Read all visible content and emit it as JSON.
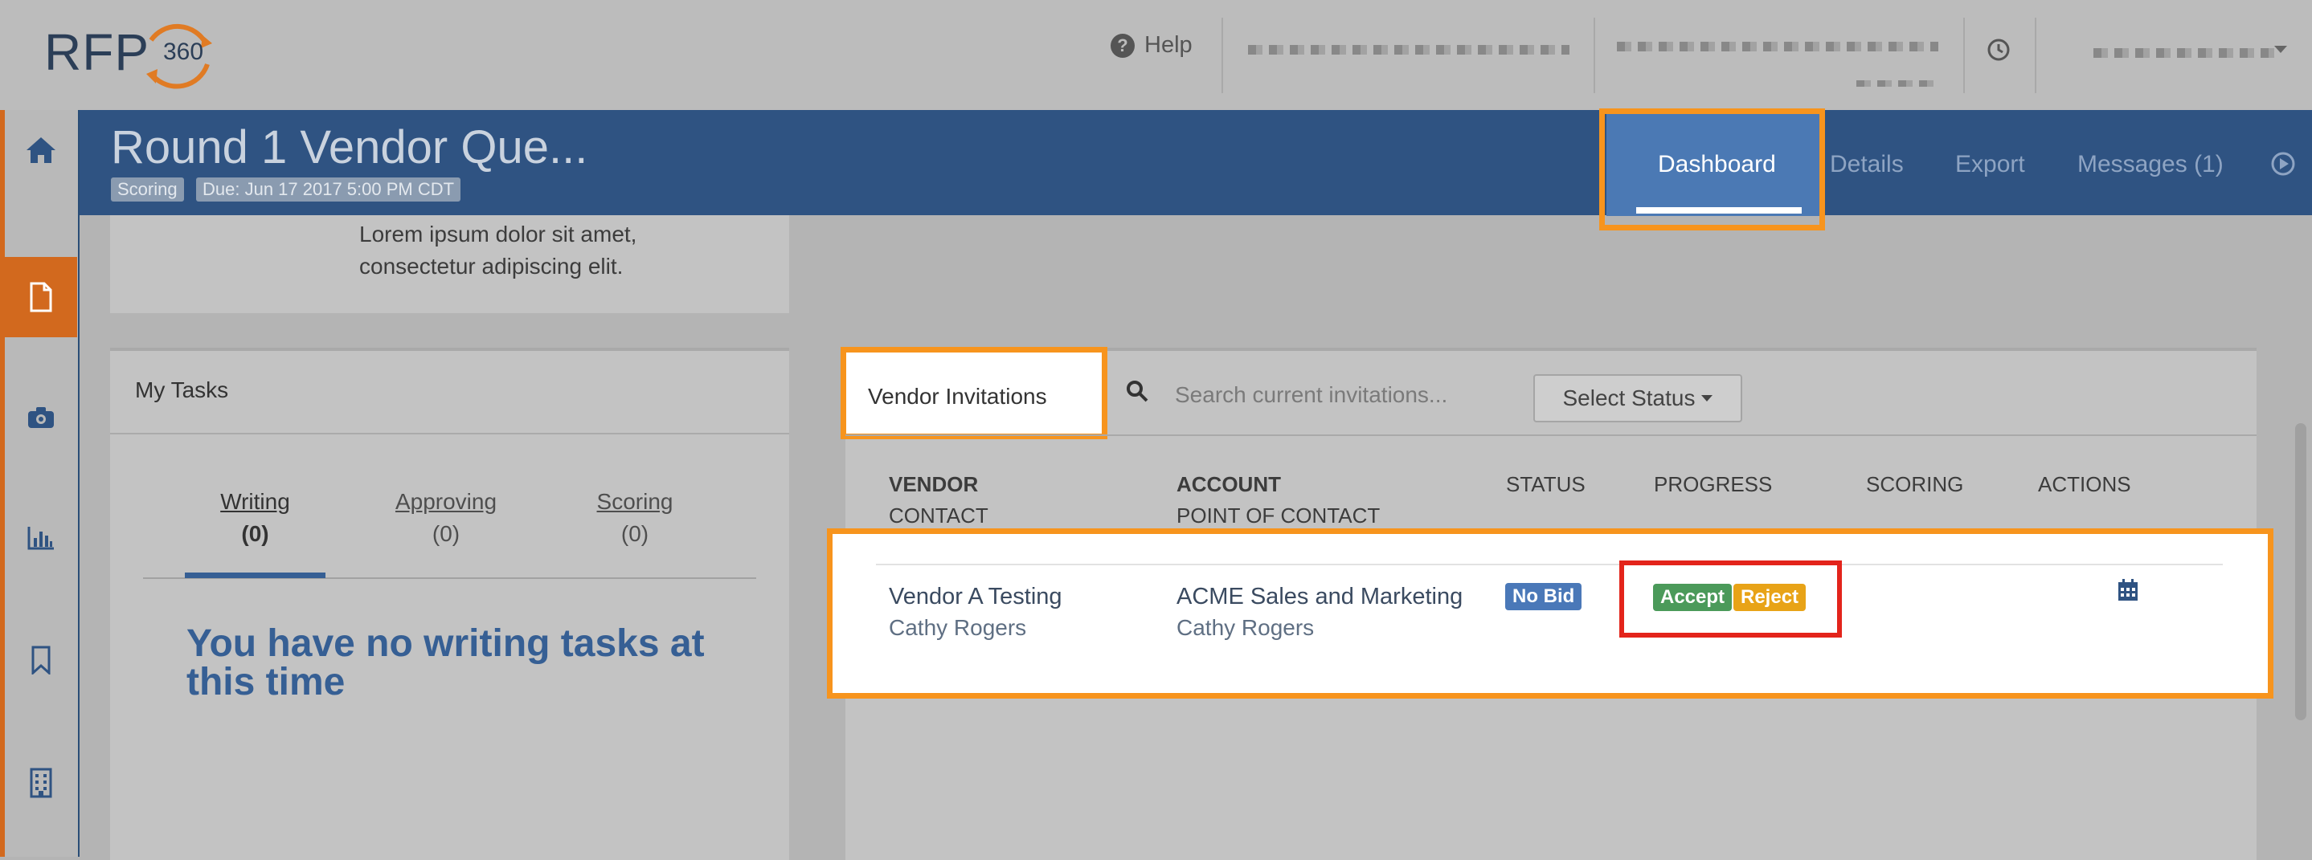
{
  "brand": {
    "logo_text": "RFP",
    "logo_badge": "360"
  },
  "top_nav": {
    "help_label": "Help"
  },
  "header": {
    "title": "Round 1 Vendor Que...",
    "badges": [
      "Scoring",
      "Due: Jun 17 2017 5:00 PM CDT"
    ],
    "tabs": [
      "Dashboard",
      "Details",
      "Export",
      "Messages (1)"
    ],
    "active_tab": "Dashboard"
  },
  "sidebar": {
    "icons": [
      "home-icon",
      "document-icon",
      "camera-icon",
      "bar-chart-icon",
      "bookmark-icon",
      "building-icon"
    ]
  },
  "intro": {
    "text_line1": "Lorem ipsum dolor sit amet,",
    "text_line2": "consectetur adipiscing elit."
  },
  "tasks": {
    "title": "My Tasks",
    "tabs": [
      {
        "label": "Writing",
        "count": "(0)"
      },
      {
        "label": "Approving",
        "count": "(0)"
      },
      {
        "label": "Scoring",
        "count": "(0)"
      }
    ],
    "active_tab": "Writing",
    "empty_message": "You have no writing tasks at this time"
  },
  "invitations": {
    "tab_label": "Vendor Invitations",
    "search_placeholder": "Search current invitations...",
    "status_select": "Select Status",
    "columns": {
      "vendor": "VENDOR",
      "contact": "CONTACT",
      "account": "ACCOUNT",
      "point_of_contact": "POINT OF CONTACT",
      "status": "STATUS",
      "progress": "PROGRESS",
      "scoring": "SCORING",
      "actions": "ACTIONS"
    },
    "rows": [
      {
        "vendor": "Vendor A Testing",
        "contact": "Cathy Rogers",
        "account": "ACME Sales and Marketing",
        "point_of_contact": "Cathy Rogers",
        "status": "No Bid",
        "accept_label": "Accept",
        "reject_label": "Reject"
      }
    ]
  },
  "colors": {
    "brand_blue": "#2f5382",
    "accent_orange": "#d2691e",
    "highlight_orange": "#f7941d",
    "highlight_red": "#e3241b",
    "accept_green": "#4b9a5a",
    "reject_yellow": "#e8a317",
    "nobid_blue": "#4a78b8"
  }
}
